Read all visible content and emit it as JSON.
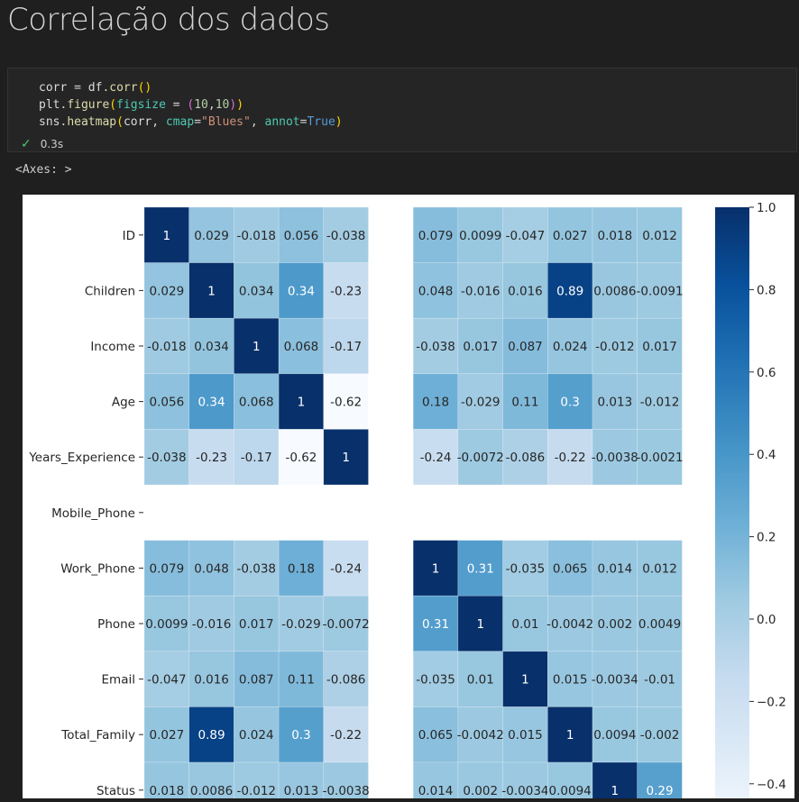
{
  "heading": "Correlação dos dados",
  "code_lines": [
    [
      [
        "corr",
        "var"
      ],
      [
        " = ",
        "op"
      ],
      [
        "df",
        "var"
      ],
      [
        ".",
        "op"
      ],
      [
        "corr",
        "fn"
      ],
      [
        "()",
        "par"
      ]
    ],
    [
      [
        "plt",
        "var"
      ],
      [
        ".",
        "op"
      ],
      [
        "figure",
        "fn"
      ],
      [
        "(",
        "par"
      ],
      [
        "figsize",
        "kw"
      ],
      [
        " = ",
        "op"
      ],
      [
        "(",
        "par2"
      ],
      [
        "10",
        "num"
      ],
      [
        ",",
        "op"
      ],
      [
        "10",
        "num"
      ],
      [
        ")",
        "par2"
      ],
      [
        ")",
        "par"
      ]
    ],
    [
      [
        "sns",
        "var"
      ],
      [
        ".",
        "op"
      ],
      [
        "heatmap",
        "fn"
      ],
      [
        "(",
        "par"
      ],
      [
        "corr",
        "var"
      ],
      [
        ", ",
        "op"
      ],
      [
        "cmap",
        "kw"
      ],
      [
        "=",
        "op"
      ],
      [
        "\"Blues\"",
        "str"
      ],
      [
        ", ",
        "op"
      ],
      [
        "annot",
        "kw"
      ],
      [
        "=",
        "op"
      ],
      [
        "True",
        "bool"
      ],
      [
        ")",
        "par"
      ]
    ]
  ],
  "status": {
    "check_icon": "check-icon",
    "time": "0.3s"
  },
  "output_text": "<Axes: >",
  "chart_data": {
    "type": "heatmap",
    "cmap": "Blues",
    "row_labels": [
      "ID",
      "Children",
      "Income",
      "Age",
      "Years_Experience",
      "Mobile_Phone",
      "Work_Phone",
      "Phone",
      "Email",
      "Total_Family",
      "Status"
    ],
    "col_count_visible": 11,
    "empty_column_index": 5,
    "empty_row_index": 5,
    "values": [
      [
        1,
        0.029,
        -0.018,
        0.056,
        -0.038,
        null,
        0.079,
        0.0099,
        -0.047,
        0.027,
        0.018,
        0.012
      ],
      [
        0.029,
        1,
        0.034,
        0.34,
        -0.23,
        null,
        0.048,
        -0.016,
        0.016,
        0.89,
        0.0086,
        -0.0091
      ],
      [
        -0.018,
        0.034,
        1,
        0.068,
        -0.17,
        null,
        -0.038,
        0.017,
        0.087,
        0.024,
        -0.012,
        0.017
      ],
      [
        0.056,
        0.34,
        0.068,
        1,
        -0.62,
        null,
        0.18,
        -0.029,
        0.11,
        0.3,
        0.013,
        -0.012
      ],
      [
        -0.038,
        -0.23,
        -0.17,
        -0.62,
        1,
        null,
        -0.24,
        -0.0072,
        -0.086,
        -0.22,
        -0.0038,
        -0.0021
      ],
      [
        null,
        null,
        null,
        null,
        null,
        null,
        null,
        null,
        null,
        null,
        null,
        null
      ],
      [
        0.079,
        0.048,
        -0.038,
        0.18,
        -0.24,
        null,
        1,
        0.31,
        -0.035,
        0.065,
        0.014,
        0.012
      ],
      [
        0.0099,
        -0.016,
        0.017,
        -0.029,
        -0.0072,
        null,
        0.31,
        1,
        0.01,
        -0.0042,
        0.002,
        0.0049
      ],
      [
        -0.047,
        0.016,
        0.087,
        0.11,
        -0.086,
        null,
        -0.035,
        0.01,
        1,
        0.015,
        -0.0034,
        -0.01
      ],
      [
        0.027,
        0.89,
        0.024,
        0.3,
        -0.22,
        null,
        0.065,
        -0.0042,
        0.015,
        1,
        0.0094,
        -0.002
      ],
      [
        0.018,
        0.0086,
        -0.012,
        0.013,
        -0.0038,
        null,
        0.014,
        0.002,
        -0.0034,
        0.0094,
        1,
        0.29
      ]
    ],
    "colorbar": {
      "min": -0.62,
      "max": 1.0,
      "ticks": [
        "1.0",
        "0.8",
        "0.6",
        "0.4",
        "0.2",
        "0.0",
        "−0.2",
        "−0.4"
      ]
    }
  }
}
